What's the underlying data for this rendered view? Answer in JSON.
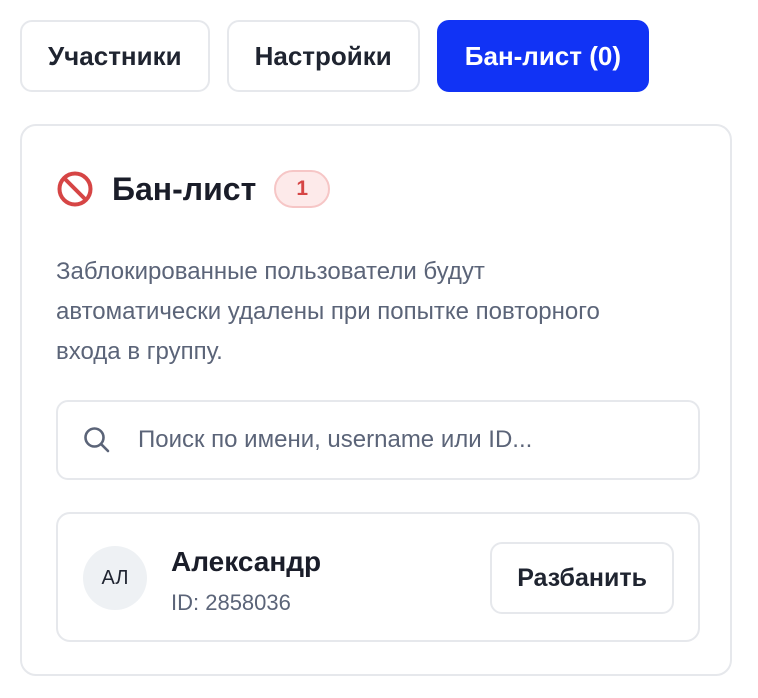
{
  "tabs": [
    {
      "label": "Участники",
      "active": false
    },
    {
      "label": "Настройки",
      "active": false
    },
    {
      "label": "Бан-лист (0)",
      "active": true
    }
  ],
  "banlist": {
    "icon": "no-entry-icon",
    "title": "Бан-лист",
    "count": "1",
    "description": "Заблокированные пользователи будут автоматически удалены при попытке повторного входа в группу.",
    "search": {
      "icon": "search-icon",
      "placeholder": "Поиск по имени, username или ID...",
      "value": ""
    },
    "users": [
      {
        "initials": "АЛ",
        "name": "Александр",
        "id_text": "ID: 2858036",
        "action_label": "Разбанить"
      }
    ]
  },
  "colors": {
    "accent": "#1133f5",
    "danger": "#d64545",
    "danger_bg": "#fdeaea",
    "muted_text": "#5b6478",
    "border": "#e6e8ec"
  }
}
